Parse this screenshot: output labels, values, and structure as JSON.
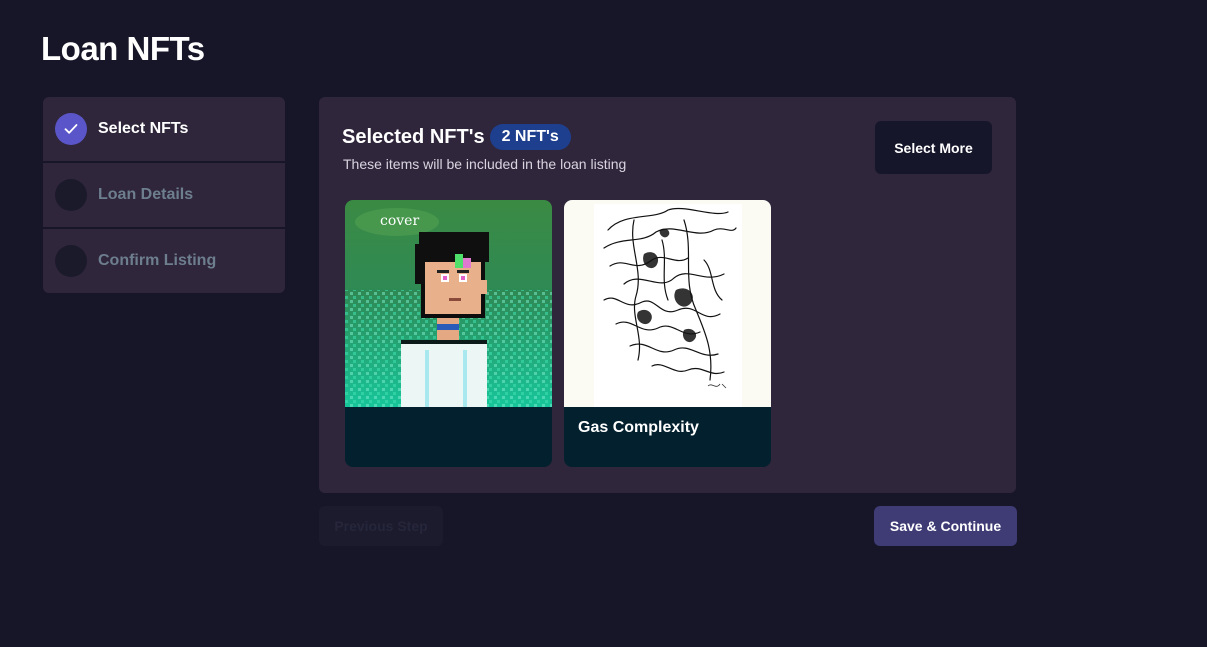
{
  "page": {
    "title": "Loan NFTs"
  },
  "steps": [
    {
      "label": "Select NFTs",
      "completed": true
    },
    {
      "label": "Loan Details",
      "completed": false
    },
    {
      "label": "Confirm Listing",
      "completed": false
    }
  ],
  "selection": {
    "title": "Selected NFT's",
    "count_badge": "2 NFT's",
    "subtitle": "These items will be included in the loan listing",
    "select_more_label": "Select More"
  },
  "nfts": [
    {
      "name": "",
      "image_overlay_text": "cover",
      "image_icon": "pixel-avatar-image"
    },
    {
      "name": "Gas Complexity",
      "image_icon": "ink-sketch-artwork-image"
    }
  ],
  "footer": {
    "previous_label": "Previous Step",
    "save_label": "Save & Continue"
  },
  "colors": {
    "background": "#171628",
    "card": "#30263b",
    "accent": "#5a55c9",
    "badge": "#1e3f8e",
    "primary_button": "#3e3b75",
    "nft_footer": "#03202f"
  }
}
